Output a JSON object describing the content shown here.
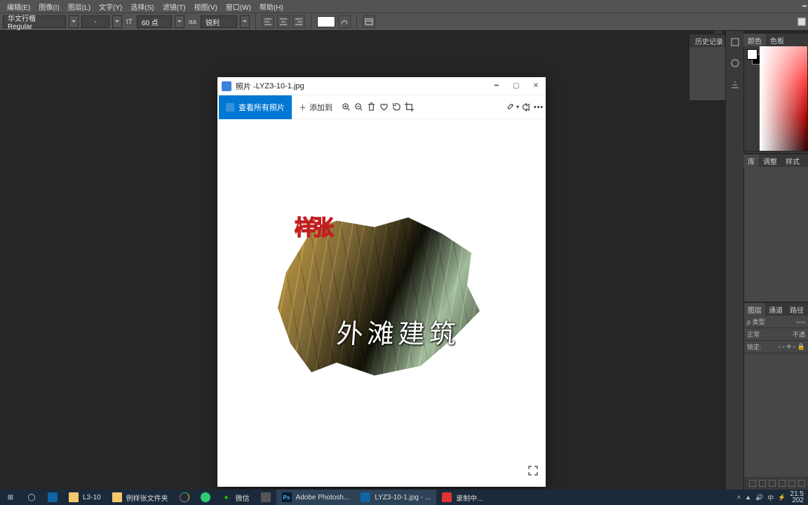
{
  "ps_menu": [
    "编辑(E)",
    "图像(I)",
    "图层(L)",
    "文字(Y)",
    "选择(S)",
    "滤镜(T)",
    "视图(V)",
    "窗口(W)",
    "帮助(H)"
  ],
  "options": {
    "font_family": "华文行楷 Regular",
    "font_style": "-",
    "tT_label": "tT",
    "font_size": "60 点",
    "aa_label": "aa",
    "aa_mode": "锐利"
  },
  "photos_window": {
    "title_prefix": "照片 - ",
    "filename": "LYZ3-10-1.jpg",
    "primary_btn": "查看所有照片",
    "add_btn": "添加到"
  },
  "artwork": {
    "stamp": "样张",
    "calligraphy": "外滩建筑"
  },
  "panels": {
    "history_tab": "历史记录",
    "color_tabs": [
      "颜色",
      "色板"
    ],
    "lib_tabs": [
      "库",
      "调整",
      "样式"
    ],
    "layer_tabs": [
      "图层",
      "通道",
      "路径"
    ],
    "layer_kind_label": "ρ 类型",
    "layer_blend": "正常",
    "layer_opacity_label": "不透",
    "layer_lock_label": "锁定:"
  },
  "taskbar": {
    "items": [
      {
        "label": "L3-10"
      },
      {
        "label": "例样张文件夹"
      },
      {
        "label": ""
      },
      {
        "label": ""
      },
      {
        "label": "微信"
      },
      {
        "label": ""
      },
      {
        "label": "Adobe Photosh..."
      },
      {
        "label": "LYZ3-10-1.jpg - ..."
      },
      {
        "label": "录制中..."
      }
    ],
    "clock_time": "21:5",
    "clock_date": "202"
  }
}
